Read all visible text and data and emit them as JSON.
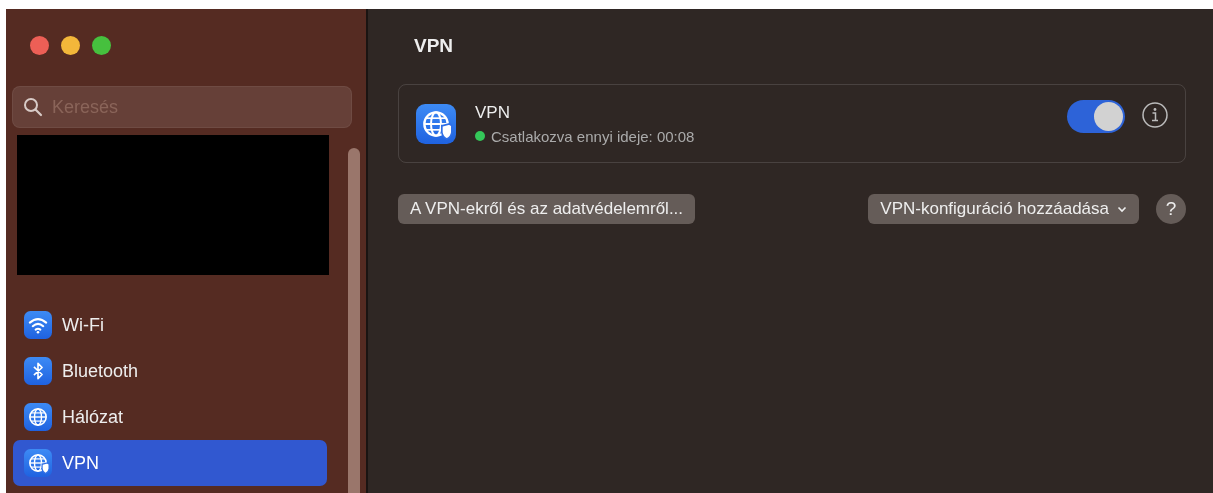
{
  "window": {
    "title": "VPN"
  },
  "sidebar": {
    "search": {
      "placeholder": "Keresés"
    },
    "items": [
      {
        "label": "Wi-Fi",
        "kind": "wifi",
        "selected": false
      },
      {
        "label": "Bluetooth",
        "kind": "bluetooth",
        "selected": false
      },
      {
        "label": "Hálózat",
        "kind": "network",
        "selected": false
      },
      {
        "label": "VPN",
        "kind": "vpn",
        "selected": true
      }
    ]
  },
  "vpn_card": {
    "name": "VPN",
    "status": "Csatlakozva ennyi ideje: 00:08",
    "connected": true,
    "on": true
  },
  "buttons": [
    {
      "label": "A VPN-ekről és az adatvédelemről...",
      "kind": "plain"
    },
    {
      "label": "VPN-konfiguráció hozzáadása",
      "kind": "dropdown"
    },
    {
      "label": "?",
      "kind": "help"
    }
  ]
}
